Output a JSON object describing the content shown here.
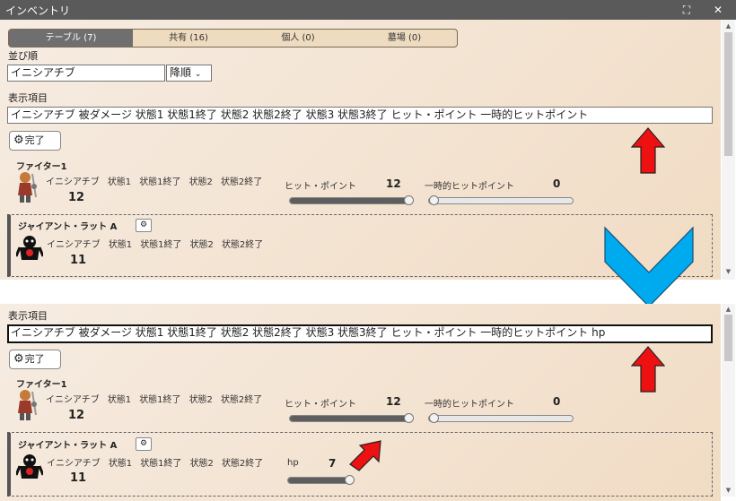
{
  "window": {
    "title": "インベントリ",
    "maximize_icon": "⛶",
    "close_icon": "✕"
  },
  "tabs": [
    {
      "label": "テーブル (7)",
      "active": true
    },
    {
      "label": "共有 (16)",
      "active": false
    },
    {
      "label": "個人 (0)",
      "active": false
    },
    {
      "label": "墓場 (0)",
      "active": false
    }
  ],
  "sort": {
    "label": "並び順",
    "field_value": "イニシアチブ",
    "order_value": "降順"
  },
  "display_fields": {
    "label": "表示項目",
    "before": "イニシアチブ 被ダメージ 状態1 状態1終了 状態2 状態2終了 状態3 状態3終了 ヒット・ポイント 一時的ヒットポイント",
    "after": "イニシアチブ 被ダメージ 状態1 状態1終了 状態2 状態2終了 状態3 状態3終了 ヒット・ポイント 一時的ヒットポイント hp"
  },
  "done_button": "完了",
  "fighter": {
    "name": "ファイター1",
    "fields": [
      "イニシアチブ",
      "状態1",
      "状態1終了",
      "状態2",
      "状態2終了"
    ],
    "initiative": "12",
    "hp_label": "ヒット・ポイント",
    "hp_value": "12",
    "hp_fraction": 1.0,
    "temp_label": "一時的ヒットポイント",
    "temp_value": "0",
    "temp_fraction": 0.0
  },
  "rat": {
    "name": "ジャイアント・ラット A",
    "fields": [
      "イニシアチブ",
      "状態1",
      "状態1終了",
      "状態2",
      "状態2終了"
    ],
    "initiative": "11",
    "hp_label": "hp",
    "hp_value": "7",
    "hp_fraction": 1.0
  },
  "colors": {
    "red_arrow": "#ee1111",
    "blue_chevron": "#00aaee"
  }
}
